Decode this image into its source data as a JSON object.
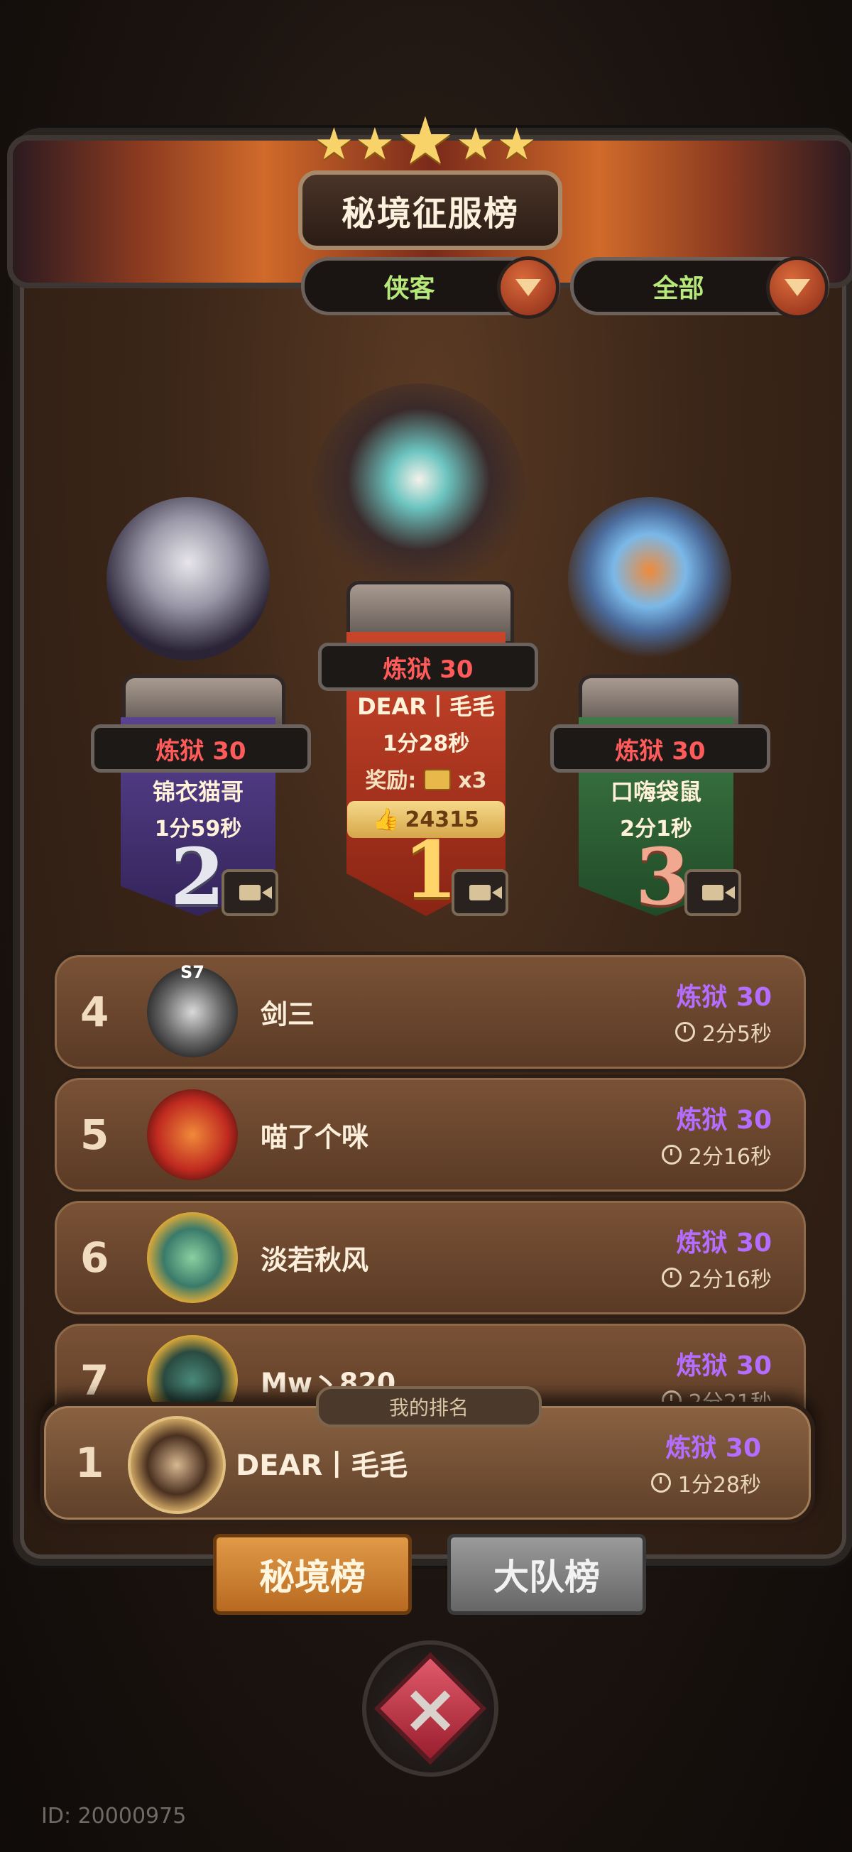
{
  "header": {
    "title": "秘境征服榜",
    "stars": [
      "★",
      "★",
      "★",
      "★",
      "★"
    ]
  },
  "filters": {
    "class_filter": "侠客",
    "scope_filter": "全部"
  },
  "podium": [
    {
      "rank": "2",
      "tier": "炼狱 30",
      "name": "锦衣猫哥",
      "time": "1分59秒",
      "color": "#4a3478"
    },
    {
      "rank": "1",
      "tier": "炼狱 30",
      "name": "DEAR丨毛毛",
      "time": "1分28秒",
      "reward_label": "奖励:",
      "reward_count": "x3",
      "likes": "24315",
      "color": "#a8341e"
    },
    {
      "rank": "3",
      "tier": "炼狱 30",
      "name": "口嗨袋鼠",
      "time": "2分1秒",
      "color": "#2e5a34"
    }
  ],
  "rows": [
    {
      "rank": "4",
      "name": "剑三",
      "tier": "炼狱 30",
      "time": "2分5秒",
      "badge": "S7"
    },
    {
      "rank": "5",
      "name": "喵了个咪",
      "tier": "炼狱 30",
      "time": "2分16秒"
    },
    {
      "rank": "6",
      "name": "淡若秋风",
      "tier": "炼狱 30",
      "time": "2分16秒"
    },
    {
      "rank": "7",
      "name": "Mw丶820",
      "tier": "炼狱 30",
      "time": "2分21秒"
    }
  ],
  "my_rank": {
    "label": "我的排名",
    "rank": "1",
    "name": "DEAR丨毛毛",
    "tier": "炼狱 30",
    "time": "1分28秒"
  },
  "tabs": {
    "dungeon": "秘境榜",
    "team": "大队榜"
  },
  "player_id": "ID: 20000975"
}
